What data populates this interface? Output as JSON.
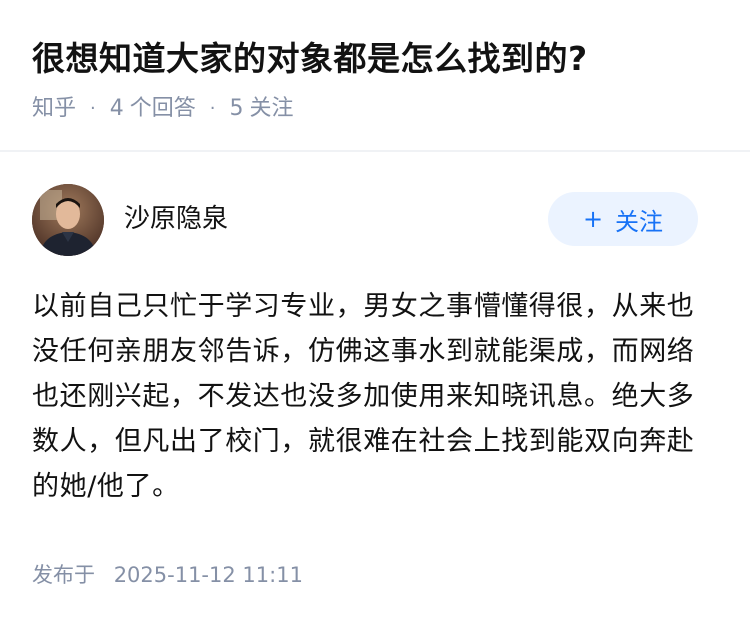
{
  "question": {
    "title": "很想知道大家的对象都是怎么找到的?",
    "source": "知乎",
    "separator": "·",
    "answers_count": "4",
    "answers_label": "个回答",
    "followers_count": "5",
    "followers_label": "关注"
  },
  "author": {
    "name": "沙原隐泉",
    "follow_plus": "+",
    "follow_label": "关注"
  },
  "answer": {
    "content": "以前自己只忙于学习专业，男女之事懵懂得很，从来也没任何亲朋友邻告诉，仿佛这事水到就能渠成，而网络也还刚兴起，不发达也没多加使用来知晓讯息。绝大多数人，但凡出了校门，就很难在社会上找到能双向奔赴的她/他了。",
    "published_label": "发布于",
    "published_time": "2025-11-12 11:11"
  },
  "colors": {
    "title": "#121212",
    "meta": "#8590a6",
    "accent": "#1772f6",
    "follow_bg": "#ebf3ff",
    "divider": "#f0f2f5"
  }
}
